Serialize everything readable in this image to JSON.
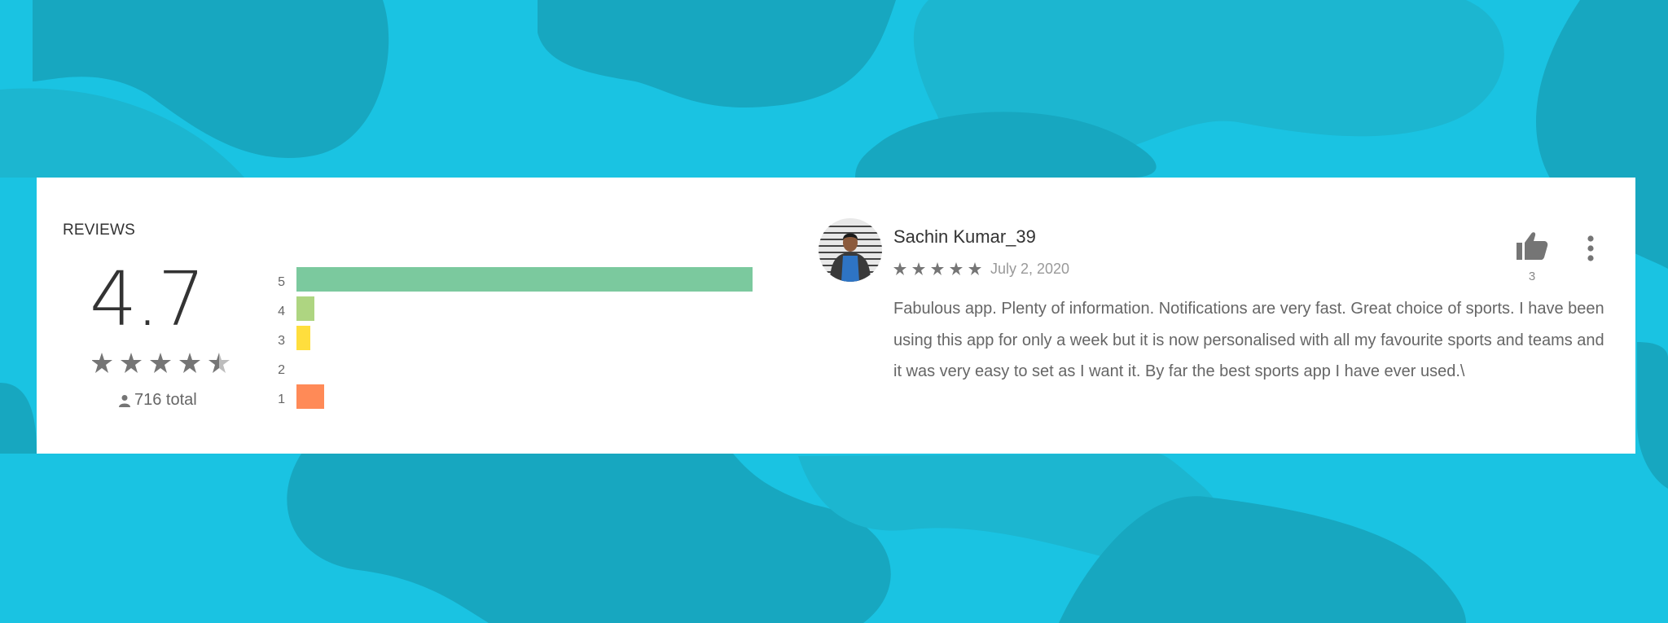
{
  "colors": {
    "background": "#1ac3e2",
    "blob": "#17a7c0",
    "card": "#ffffff",
    "bar_5": "#7bc99e",
    "bar_4": "#aed581",
    "bar_3": "#ffde3d",
    "bar_2": "#ff9a52",
    "bar_1": "#ff8a57",
    "star": "#757575"
  },
  "reviews": {
    "title": "REVIEWS",
    "average_score": "4.7",
    "average_stars": 4.7,
    "total_count": "716",
    "total_label": "716 total",
    "user_icon": "person-icon",
    "distribution": [
      {
        "label": "5",
        "fraction": 1.0
      },
      {
        "label": "4",
        "fraction": 0.04
      },
      {
        "label": "3",
        "fraction": 0.03
      },
      {
        "label": "2",
        "fraction": 0.0
      },
      {
        "label": "1",
        "fraction": 0.06
      }
    ]
  },
  "review": {
    "reviewer_name": "Sachin Kumar_39",
    "stars": 5,
    "date": "July 2, 2020",
    "text": "Fabulous app. Plenty of information. Notifications are very fast. Great choice of sports. I have been using this app for only a week but it is now personalised with all my favourite sports and teams and it was very easy to set as I want it. By far the best sports app I have ever used.\\",
    "like_icon": "thumbs-up-icon",
    "like_count": "3",
    "more_icon": "more-vertical-icon"
  }
}
